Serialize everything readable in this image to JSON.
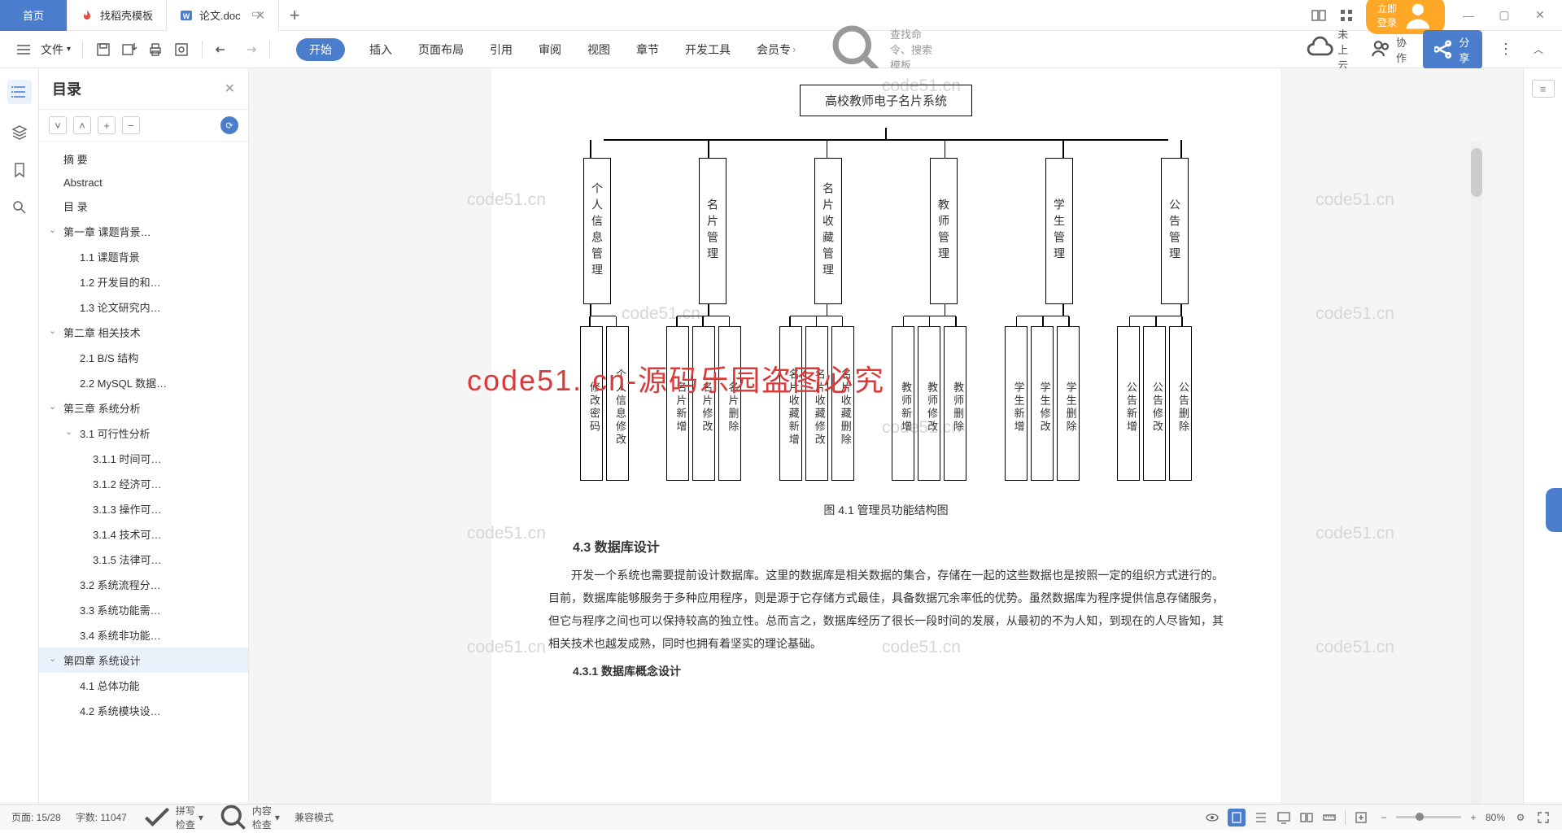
{
  "tabs": {
    "home": "首页",
    "t1": "找稻壳模板",
    "t2": "论文.doc"
  },
  "login": "立即登录",
  "file_label": "文件",
  "menu": {
    "start": "开始",
    "insert": "插入",
    "layout": "页面布局",
    "ref": "引用",
    "review": "审阅",
    "view": "视图",
    "section": "章节",
    "dev": "开发工具",
    "member": "会员专"
  },
  "search_ph": "查找命令、搜索模板",
  "cloud": "未上云",
  "collab": "协作",
  "share": "分享",
  "outline_title": "目录",
  "outline": [
    {
      "lv": 1,
      "t": "摘    要"
    },
    {
      "lv": 1,
      "t": "Abstract"
    },
    {
      "lv": 1,
      "t": "目    录"
    },
    {
      "lv": 1,
      "t": "第一章  课题背景…",
      "c": true
    },
    {
      "lv": 2,
      "t": "1.1 课题背景"
    },
    {
      "lv": 2,
      "t": "1.2 开发目的和…"
    },
    {
      "lv": 2,
      "t": "1.3 论文研究内…"
    },
    {
      "lv": 1,
      "t": "第二章  相关技术",
      "c": true
    },
    {
      "lv": 2,
      "t": "2.1 B/S 结构"
    },
    {
      "lv": 2,
      "t": "2.2 MySQL 数据…"
    },
    {
      "lv": 1,
      "t": "第三章  系统分析",
      "c": true
    },
    {
      "lv": 2,
      "t": "3.1 可行性分析",
      "c": true
    },
    {
      "lv": 3,
      "t": "3.1.1 时间可…"
    },
    {
      "lv": 3,
      "t": "3.1.2 经济可…"
    },
    {
      "lv": 3,
      "t": "3.1.3 操作可…"
    },
    {
      "lv": 3,
      "t": "3.1.4 技术可…"
    },
    {
      "lv": 3,
      "t": "3.1.5 法律可…"
    },
    {
      "lv": 2,
      "t": "3.2 系统流程分…"
    },
    {
      "lv": 2,
      "t": "3.3 系统功能需…"
    },
    {
      "lv": 2,
      "t": "3.4 系统非功能…"
    },
    {
      "lv": 1,
      "t": "第四章  系统设计",
      "c": true,
      "sel": true
    },
    {
      "lv": 2,
      "t": "4.1 总体功能"
    },
    {
      "lv": 2,
      "t": "4.2 系统模块设…"
    }
  ],
  "watermark": "code51.cn",
  "wm_red": "code51. cn-源码乐园盗图必究",
  "chart_data": {
    "type": "tree",
    "title": "高校教师电子名片系统",
    "modules": [
      "个人信息管理",
      "名片管理",
      "名片收藏管理",
      "教师管理",
      "学生管理",
      "公告管理"
    ],
    "subs": [
      [
        "修改密码",
        "个人信息修改"
      ],
      [
        "名片新增",
        "名片修改",
        "名片删除"
      ],
      [
        "名片收藏新增",
        "名片收藏修改",
        "名片收藏删除"
      ],
      [
        "教师新增",
        "教师修改",
        "教师删除"
      ],
      [
        "学生新增",
        "学生修改",
        "学生删除"
      ],
      [
        "公告新增",
        "公告修改",
        "公告删除"
      ]
    ]
  },
  "caption": "图 4.1 管理员功能结构图",
  "h43": "4.3  数据库设计",
  "p1": "开发一个系统也需要提前设计数据库。这里的数据库是相关数据的集合，存储在一起的这些数据也是按照一定的组织方式进行的。目前，数据库能够服务于多种应用程序，则是源于它存储方式最佳，具备数据冗余率低的优势。虽然数据库为程序提供信息存储服务，但它与程序之间也可以保持较高的独立性。总而言之，数据库经历了很长一段时间的发展，从最初的不为人知，到现在的人尽皆知，其相关技术也越发成熟，同时也拥有着坚实的理论基础。",
  "h431": "4.3.1  数据库概念设计",
  "status": {
    "page": "页面: 15/28",
    "words": "字数: 11047",
    "spell": "拼写检查",
    "content": "内容检查",
    "compat": "兼容模式",
    "zoom": "80%"
  }
}
